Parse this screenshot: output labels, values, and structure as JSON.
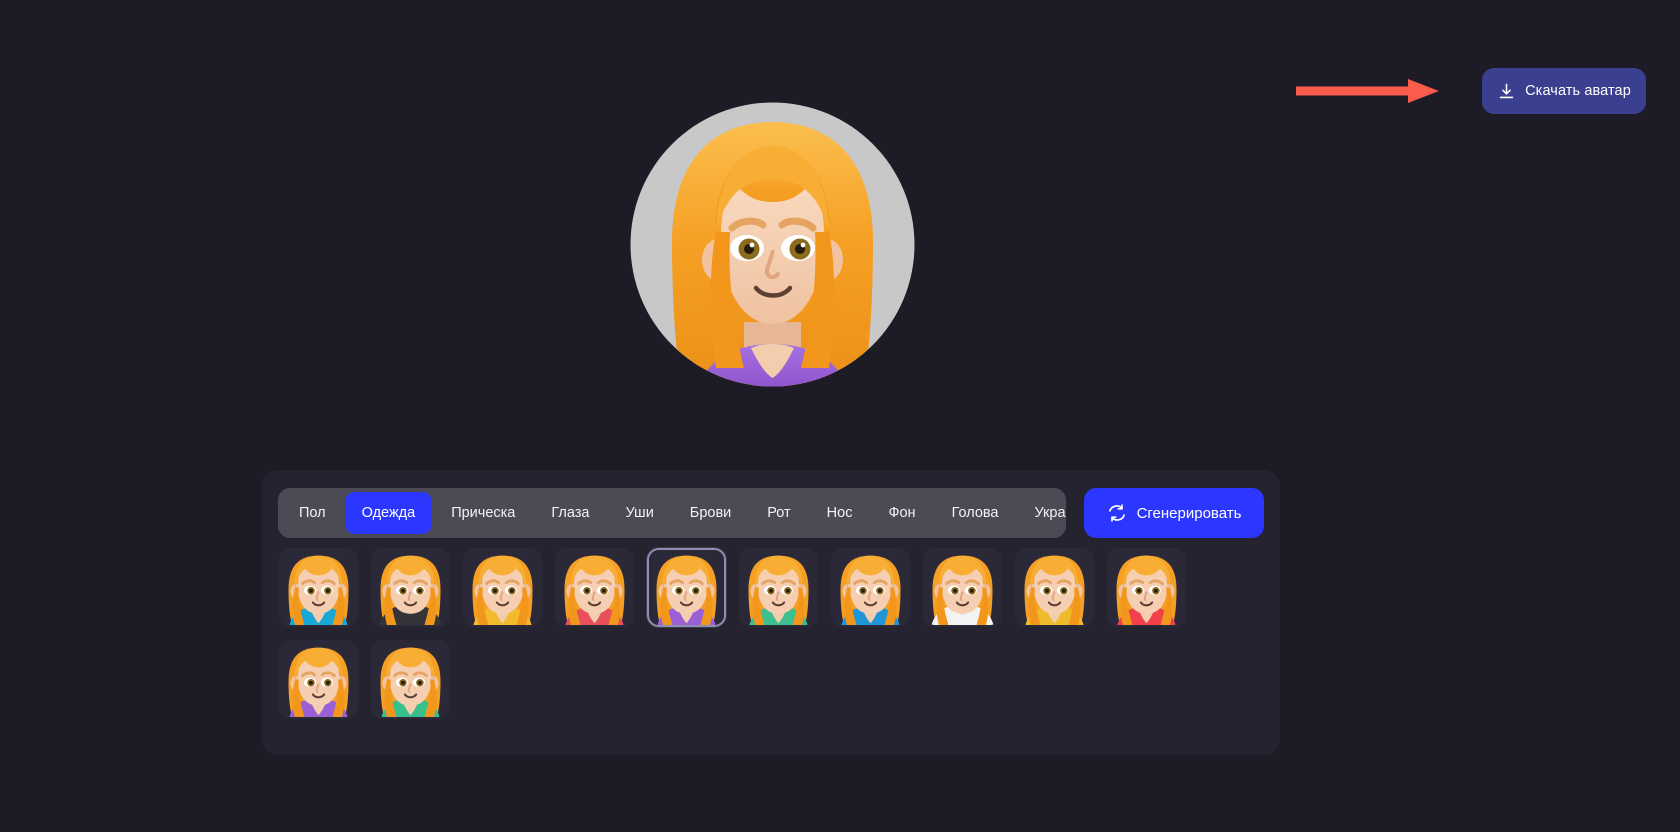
{
  "app": {
    "background_color": "#1d1b25",
    "panel_color": "#252330",
    "accent_color": "#2b37ff",
    "annotation_color": "#fa5c4b"
  },
  "header": {
    "download_button": {
      "label": "Скачать аватар",
      "icon": "download-icon",
      "color": "#3b3f8f"
    },
    "annotation_arrow": {
      "name": "red-pointer-arrow",
      "color": "#fa5c4b",
      "points_to": "download-button"
    }
  },
  "preview": {
    "name": "avatar-preview",
    "background_circle_color": "#c8c8c8",
    "hair_color": "#f5a024",
    "skin_color": "#f6cfb2",
    "clothing_color": "#9b5fd6",
    "eye_color": "#8a6a1c"
  },
  "editor": {
    "tabs": [
      {
        "label": "Пол",
        "active": false
      },
      {
        "label": "Одежда",
        "active": true
      },
      {
        "label": "Прическа",
        "active": false
      },
      {
        "label": "Глаза",
        "active": false
      },
      {
        "label": "Уши",
        "active": false
      },
      {
        "label": "Брови",
        "active": false
      },
      {
        "label": "Рот",
        "active": false
      },
      {
        "label": "Нос",
        "active": false
      },
      {
        "label": "Фон",
        "active": false
      },
      {
        "label": "Голова",
        "active": false
      },
      {
        "label": "Украшения",
        "active": false
      }
    ],
    "generate_button": {
      "label": "Сгенерировать",
      "icon": "refresh-cycle-icon"
    },
    "options": [
      {
        "index": 1,
        "clothing_color": "#18a8d8",
        "selected": false
      },
      {
        "index": 2,
        "clothing_color": "#343439",
        "selected": false
      },
      {
        "index": 3,
        "clothing_color": "#f2bb2e",
        "selected": false
      },
      {
        "index": 4,
        "clothing_color": "#e8505b",
        "selected": false
      },
      {
        "index": 5,
        "clothing_color": "#9b5fd6",
        "selected": true
      },
      {
        "index": 6,
        "clothing_color": "#3dbf8f",
        "selected": false
      },
      {
        "index": 7,
        "clothing_color": "#2196d6",
        "selected": false
      },
      {
        "index": 8,
        "clothing_color": "#f3f3f3",
        "selected": false
      },
      {
        "index": 9,
        "clothing_color": "#efbb2a",
        "selected": false
      },
      {
        "index": 10,
        "clothing_color": "#f0404a",
        "selected": false
      },
      {
        "index": 11,
        "clothing_color": "#9b5fd6",
        "selected": false
      },
      {
        "index": 12,
        "clothing_color": "#35c08c",
        "selected": false
      }
    ]
  }
}
